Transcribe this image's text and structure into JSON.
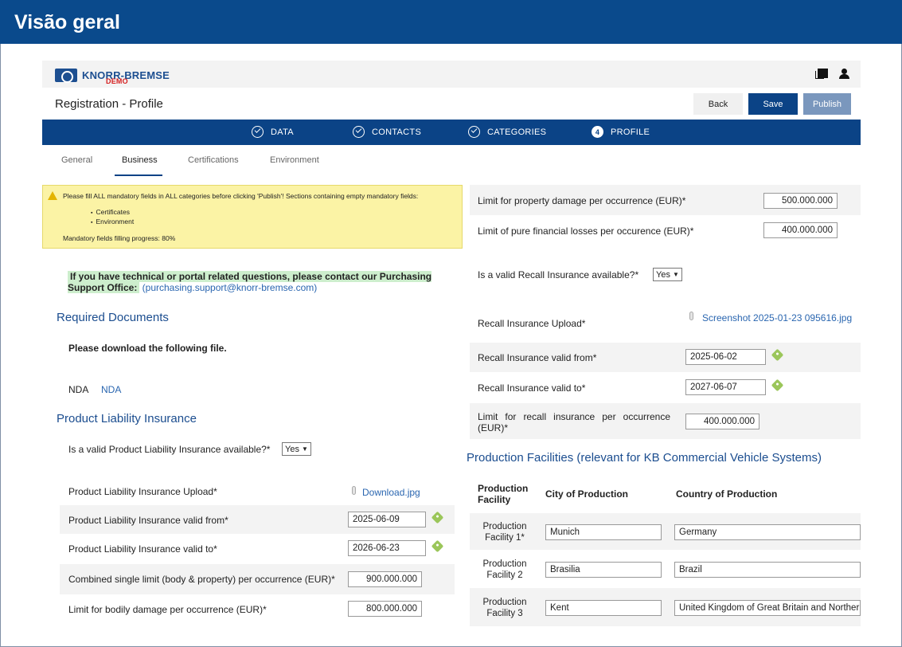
{
  "window": {
    "title": "Visão geral"
  },
  "brand": {
    "name": "KNORR-BREMSE",
    "demo": "DEMO"
  },
  "header": {
    "page_title": "Registration - Profile",
    "back_label": "Back",
    "save_label": "Save",
    "publish_label": "Publish"
  },
  "steps": [
    {
      "label": "DATA",
      "status": "done"
    },
    {
      "label": "CONTACTS",
      "status": "done"
    },
    {
      "label": "CATEGORIES",
      "status": "done"
    },
    {
      "label": "PROFILE",
      "number": "4",
      "status": "current"
    }
  ],
  "tabs": [
    {
      "label": "General"
    },
    {
      "label": "Business",
      "active": true
    },
    {
      "label": "Certifications"
    },
    {
      "label": "Environment"
    }
  ],
  "warning": {
    "text": "Please fill ALL mandatory fields in ALL categories before clicking 'Publish'! Sections containing empty mandatory fields:",
    "items": [
      "Certificates",
      "Environment"
    ],
    "progress": "Mandatory fields filling progress: 80%"
  },
  "contact": {
    "text": "If you have technical or portal related questions, please contact our Purchasing Support Office:",
    "email": "(purchasing.support@knorr-bremse.com)"
  },
  "required_documents": {
    "title": "Required Documents",
    "instruction": "Please download the following file.",
    "nda_label": "NDA",
    "nda_link": "NDA"
  },
  "product_liability": {
    "title": "Product Liability Insurance",
    "available_label": "Is a valid Product Liability Insurance available?*",
    "available_value": "Yes",
    "upload_label": "Product Liability Insurance Upload*",
    "upload_file": "Download.jpg",
    "valid_from_label": "Product Liability Insurance valid from*",
    "valid_from_value": "2025-06-09",
    "valid_to_label": "Product Liability Insurance valid to*",
    "valid_to_value": "2026-06-23",
    "combined_limit_label": "Combined single limit (body & property) per occurrence (EUR)*",
    "combined_limit_value": "900.000.000",
    "bodily_limit_label": "Limit for bodily damage per occurrence (EUR)*",
    "bodily_limit_value": "800.000.000"
  },
  "right_panel": {
    "property_limit_label": "Limit for property damage per occurrence (EUR)*",
    "property_limit_value": "500.000.000",
    "financial_limit_label": "Limit of pure financial losses per occurence (EUR)*",
    "financial_limit_value": "400.000.000",
    "recall_available_label": "Is a valid Recall Insurance available?*",
    "recall_available_value": "Yes",
    "recall_upload_label": "Recall Insurance Upload*",
    "recall_upload_file": "Screenshot 2025-01-23 095616.jpg",
    "recall_from_label": "Recall Insurance valid from*",
    "recall_from_value": "2025-06-02",
    "recall_to_label": "Recall Insurance valid to*",
    "recall_to_value": "2027-06-07",
    "recall_limit_label_1": "Limit for recall insurance per occurrence",
    "recall_limit_label_2": "(EUR)*",
    "recall_limit_value": "400.000.000"
  },
  "production": {
    "title": "Production Facilities (relevant for KB Commercial Vehicle Systems)",
    "col_facility_1": "Production",
    "col_facility_2": "Facility",
    "col_city": "City of Production",
    "col_country": "Country of Production",
    "rows": [
      {
        "line1": "Production",
        "line2": "Facility 1*",
        "city": "Munich",
        "country": "Germany"
      },
      {
        "line1": "Production",
        "line2": "Facility 2",
        "city": "Brasilia",
        "country": "Brazil"
      },
      {
        "line1": "Production",
        "line2": "Facility 3",
        "city": "Kent",
        "country": "United Kingdom of Great Britain and Northern Ireland"
      }
    ]
  }
}
